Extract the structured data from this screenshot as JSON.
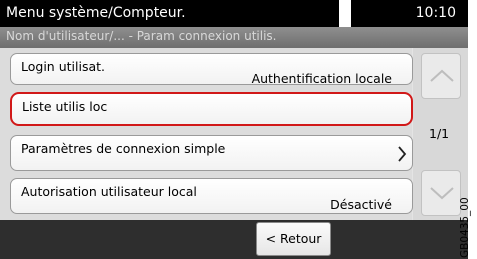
{
  "title_bar": {
    "title": "Menu système/Compteur.",
    "time": "10:10"
  },
  "breadcrumb": "Nom d'utilisateur/... - Param connexion utilis.",
  "items": [
    {
      "label": "Login utilisat.",
      "value": "Authentification locale"
    },
    {
      "label": "Liste utilis loc",
      "value": ""
    },
    {
      "label": "Paramètres de connexion simple",
      "chevron": "chevron-right-icon"
    },
    {
      "label": "Autorisation utilisateur local",
      "value": "Désactivé"
    }
  ],
  "highlight_color": "#d11818",
  "scroll": {
    "page": "1/1",
    "up_icon": "arrow-up-icon",
    "down_icon": "arrow-down-icon"
  },
  "footer": {
    "back_label": "< Retour"
  },
  "image_code": "GB0435_00"
}
